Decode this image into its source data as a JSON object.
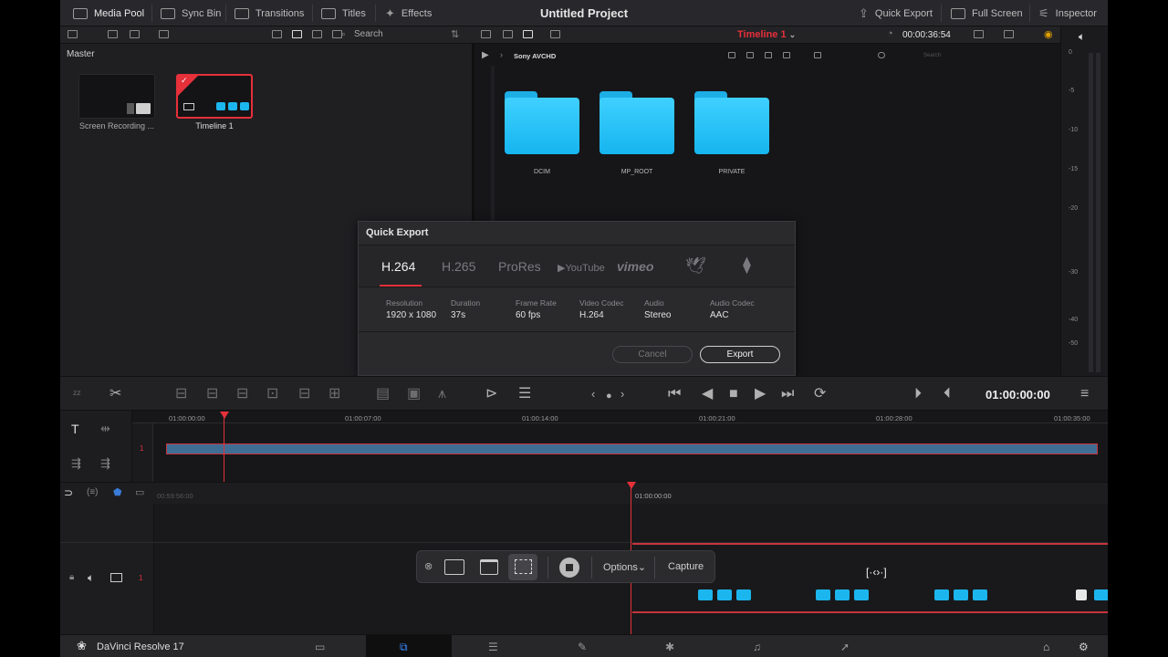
{
  "topbar": {
    "media_pool": "Media Pool",
    "sync_bin": "Sync Bin",
    "transitions": "Transitions",
    "titles": "Titles",
    "effects": "Effects",
    "project_title": "Untitled Project",
    "quick_export": "Quick Export",
    "full_screen": "Full Screen",
    "inspector": "Inspector"
  },
  "subbar": {
    "search_placeholder": "Search",
    "timeline_name": "Timeline 1",
    "timecode": "00:00:36:54"
  },
  "pool": {
    "title": "Master",
    "items": [
      {
        "label": "Screen Recording ..."
      },
      {
        "label": "Timeline 1"
      }
    ]
  },
  "browser": {
    "path": "Sony AVCHD",
    "search_placeholder": "Search",
    "folders": [
      "DCIM",
      "MP_ROOT",
      "PRIVATE"
    ]
  },
  "meters": {
    "scale": [
      "0",
      "-5",
      "-10",
      "-15",
      "-20",
      "-30",
      "-40",
      "-50"
    ]
  },
  "dialog": {
    "title": "Quick Export",
    "formats": [
      "H.264",
      "H.265",
      "ProRes",
      "YouTube",
      "vimeo"
    ],
    "active_format": "H.264",
    "specs": [
      {
        "key": "Resolution",
        "value": "1920 x 1080"
      },
      {
        "key": "Duration",
        "value": "37s"
      },
      {
        "key": "Frame Rate",
        "value": "60 fps"
      },
      {
        "key": "Video Codec",
        "value": "H.264"
      },
      {
        "key": "Audio",
        "value": "Stereo"
      },
      {
        "key": "Audio Codec",
        "value": "AAC"
      }
    ],
    "cancel": "Cancel",
    "export": "Export"
  },
  "transport": {
    "timecode": "01:00:00:00"
  },
  "upper_timeline": {
    "ticks": [
      "01:00:00:00",
      "01:00:07:00",
      "01:00:14:00",
      "01:00:21:00",
      "01:00:28:00",
      "01:00:35:00"
    ],
    "track_number": "1"
  },
  "lower_timeline": {
    "left_time": "00:59:56:00",
    "playhead_time": "01:00:00:00",
    "track_number": "1"
  },
  "capture_bar": {
    "options": "Options",
    "capture": "Capture"
  },
  "pagebar": {
    "app_name": "DaVinci Resolve 17"
  },
  "colors": {
    "accent_red": "#e6303a",
    "folder_blue": "#1cb6ee",
    "clip_blue": "#3f6d93"
  }
}
